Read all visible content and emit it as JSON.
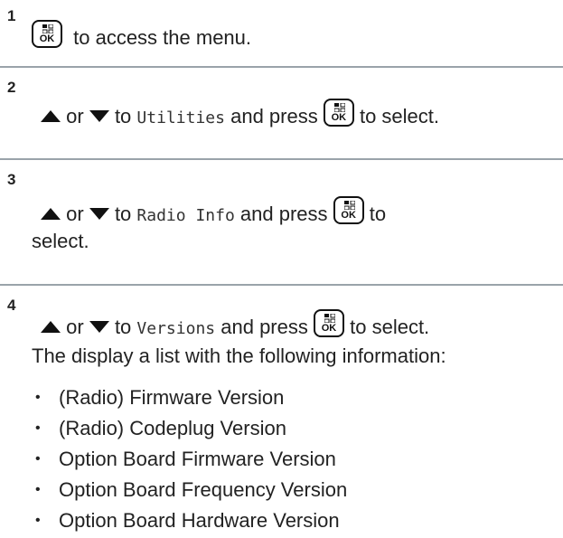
{
  "steps": [
    {
      "number": "1",
      "text": "to access the menu."
    },
    {
      "number": "2",
      "or": "or",
      "to": "to",
      "item": "Utilities",
      "press": "and press",
      "after": "to select."
    },
    {
      "number": "3",
      "or": "or",
      "to": "to",
      "item": "Radio Info",
      "press": "and press",
      "after": "to",
      "after2": "select."
    },
    {
      "number": "4",
      "or": "or",
      "to": "to",
      "item": "Versions",
      "press": "and press",
      "after": "to select.",
      "description": "The display a list with the following information:",
      "bullets": [
        "(Radio) Firmware Version",
        "(Radio) Codeplug Version",
        "Option Board Firmware Version",
        "Option Board Frequency Version",
        "Option Board Hardware Version"
      ]
    }
  ],
  "ok_key_label": "OK",
  "icons": {
    "ok_key": "menu-ok-key-icon",
    "up": "up-arrow-icon",
    "down": "down-arrow-icon"
  }
}
